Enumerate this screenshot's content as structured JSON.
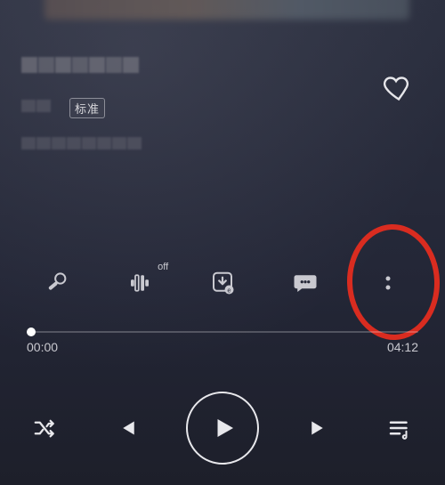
{
  "quality_badge": "标准",
  "mid_row": {
    "off_label": "off"
  },
  "progress": {
    "current": "00:00",
    "total": "04:12"
  }
}
